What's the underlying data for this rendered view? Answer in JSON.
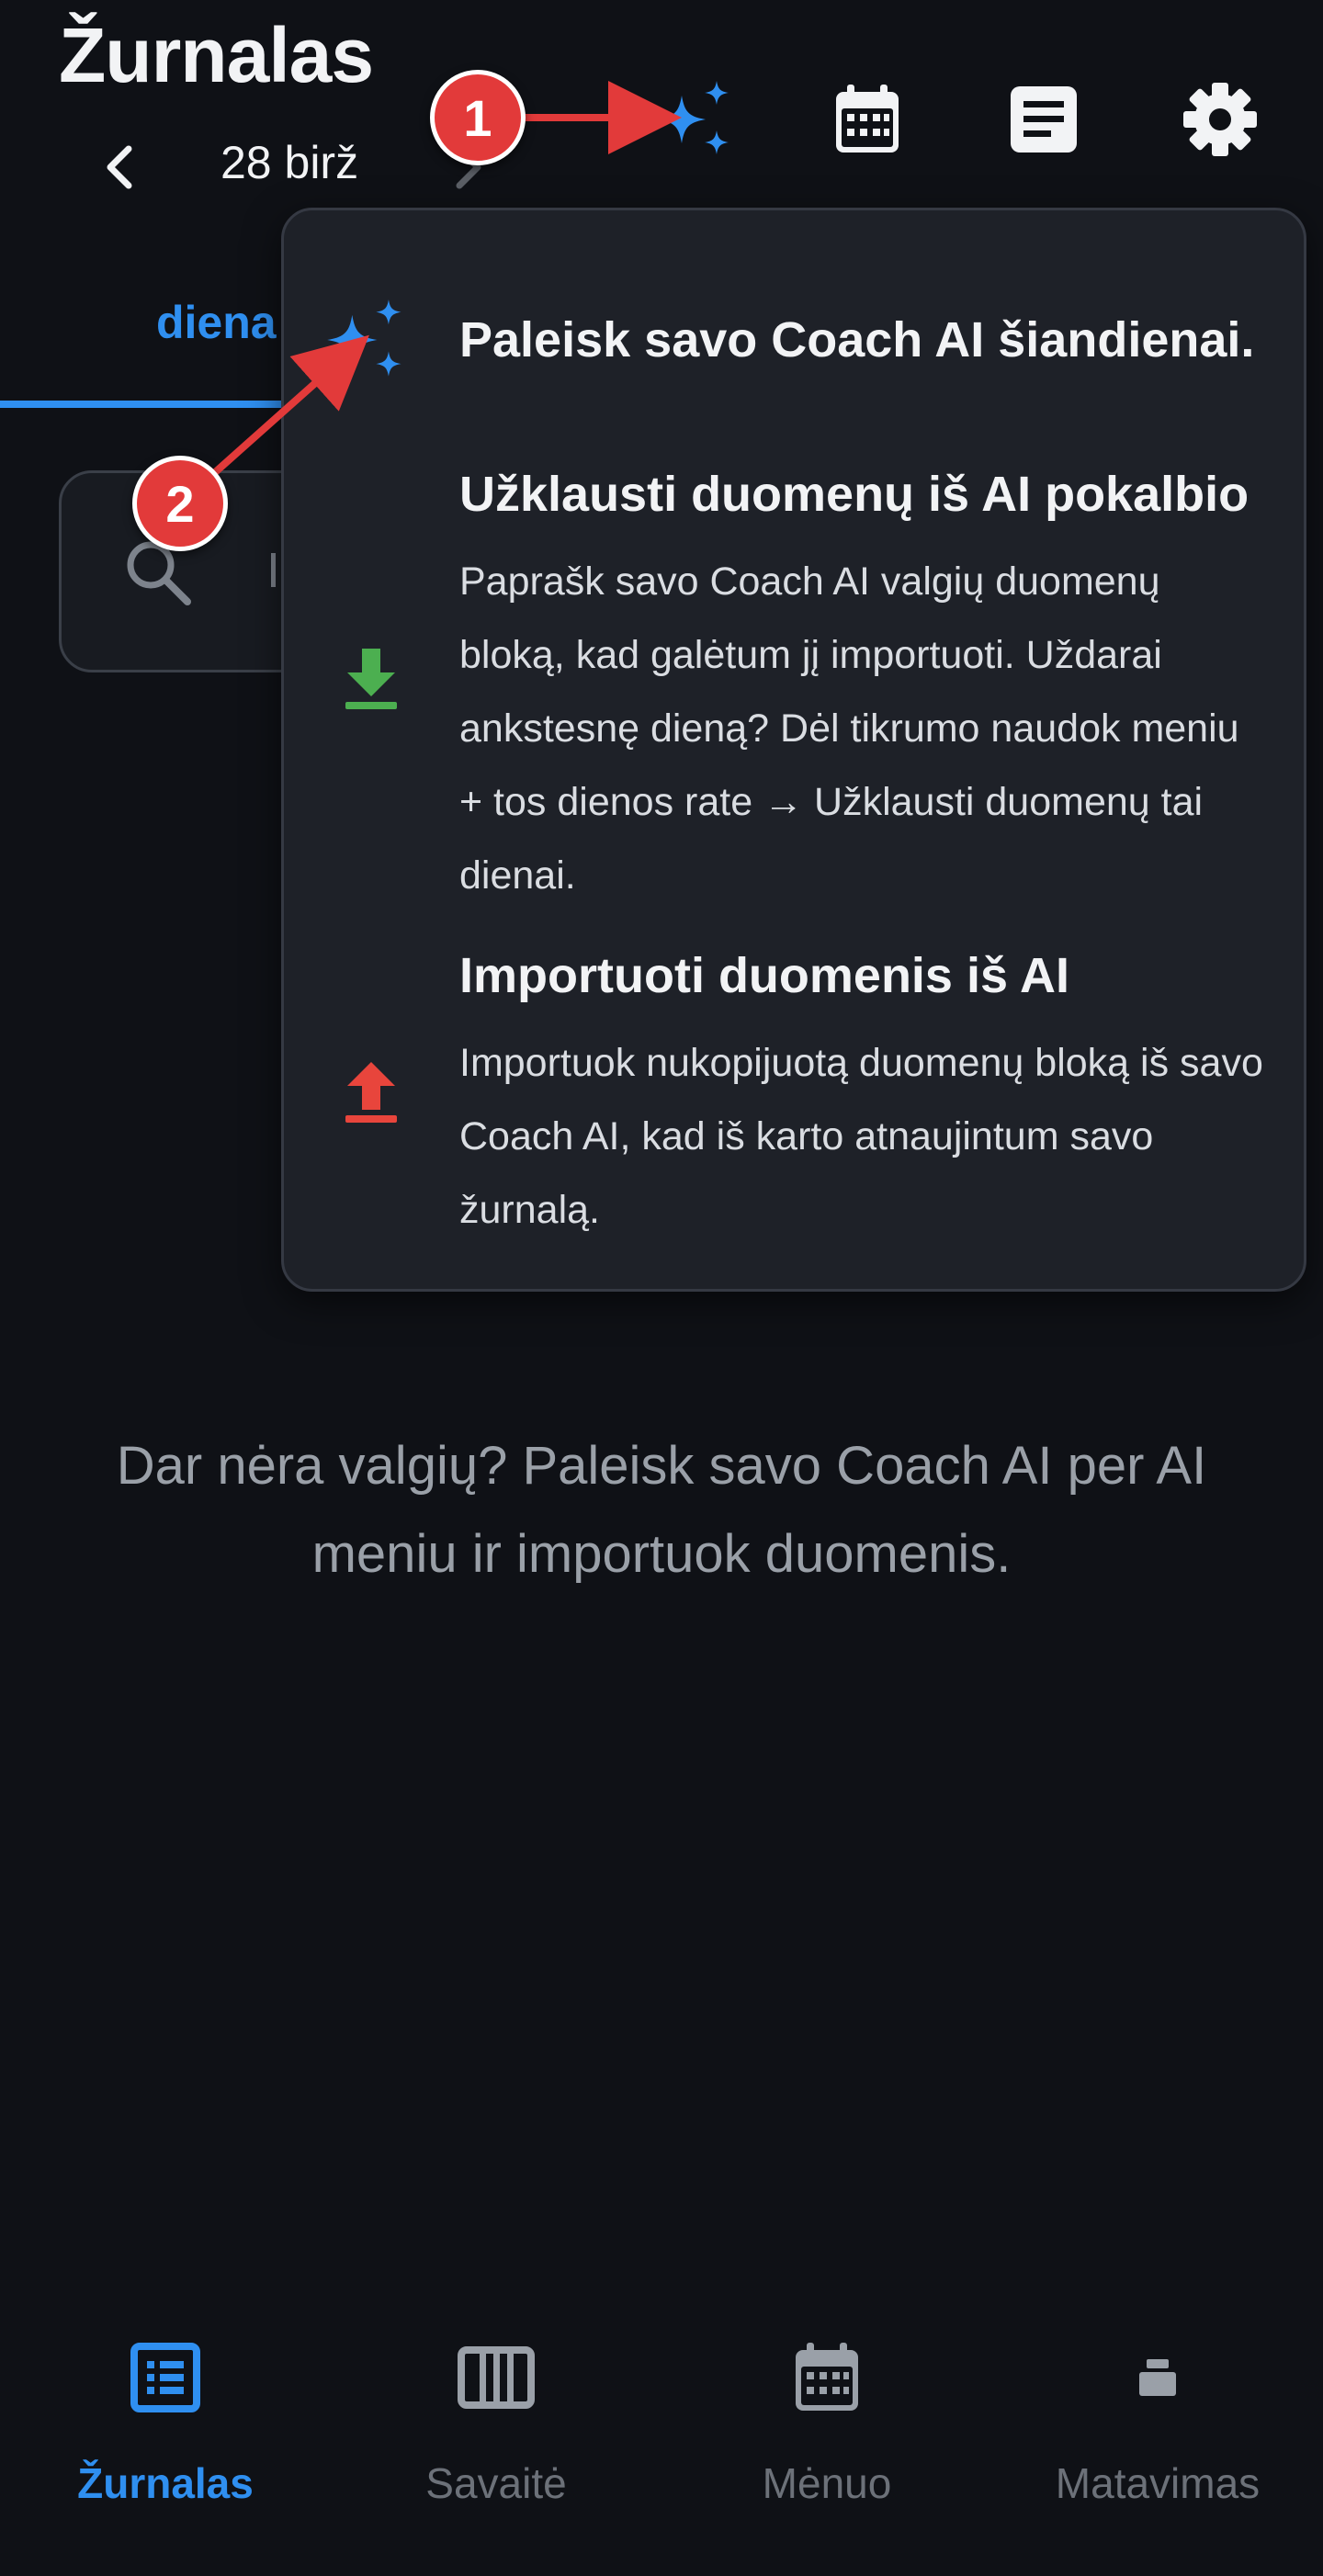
{
  "header": {
    "title": "Žurnalas",
    "date": "28 birž"
  },
  "tabs": {
    "day_label": "diena"
  },
  "search": {
    "text": "I"
  },
  "ai_menu": {
    "items": [
      {
        "title": "Paleisk savo Coach AI šiandienai.",
        "icon": "sparkles-icon"
      },
      {
        "title": "Užklausti duomenų iš AI pokalbio",
        "description": "Paprašk savo Coach AI valgių duomenų bloką, kad galėtum jį importuoti. Uždarai ankstesnę dieną? Dėl tikrumo naudok meniu + tos dienos rate → Užklausti duomenų tai dienai.",
        "icon": "download-icon"
      },
      {
        "title": "Importuoti duomenis iš AI",
        "description": "Importuok nukopijuotą duomenų bloką iš savo Coach AI, kad iš karto atnaujintum savo žurnalą.",
        "icon": "upload-icon"
      }
    ]
  },
  "empty_state": {
    "message": "Dar nėra valgių? Paleisk savo Coach AI per AI meniu ir importuok duomenis."
  },
  "bottom_nav": {
    "items": [
      {
        "label": "Žurnalas",
        "active": true,
        "icon": "list-icon"
      },
      {
        "label": "Savaitė",
        "active": false,
        "icon": "week-columns-icon"
      },
      {
        "label": "Mėnuo",
        "active": false,
        "icon": "calendar-icon"
      },
      {
        "label": "Matavimas",
        "active": false,
        "icon": "measure-icon"
      }
    ]
  },
  "annotations": {
    "badge_1": "1",
    "badge_2": "2"
  },
  "colors": {
    "background": "#0f1116",
    "accent_blue": "#2f8ff0",
    "download_green": "#4caf50",
    "upload_red": "#e8453c",
    "annotation_red": "#e23a3a"
  }
}
